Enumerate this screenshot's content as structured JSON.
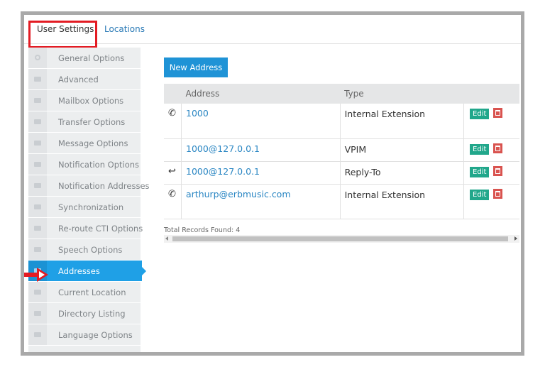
{
  "tabs": [
    {
      "label": "User Settings",
      "active": true
    },
    {
      "label": "Locations",
      "active": false
    }
  ],
  "sidebar": {
    "items": [
      {
        "label": "General Options",
        "icon": "gear-icon"
      },
      {
        "label": "Advanced",
        "icon": "envelope-icon"
      },
      {
        "label": "Mailbox Options",
        "icon": "envelope-icon"
      },
      {
        "label": "Transfer Options",
        "icon": "envelope-icon"
      },
      {
        "label": "Message Options",
        "icon": "envelope-icon"
      },
      {
        "label": "Notification Options",
        "icon": "envelope-icon"
      },
      {
        "label": "Notification Addresses",
        "icon": "envelope-icon"
      },
      {
        "label": "Synchronization",
        "icon": "envelope-icon"
      },
      {
        "label": "Re-route CTI Options",
        "icon": "envelope-icon"
      },
      {
        "label": "Speech Options",
        "icon": "envelope-icon"
      },
      {
        "label": "Addresses",
        "icon": "envelope-icon",
        "active": true
      },
      {
        "label": "Current Location",
        "icon": "envelope-icon"
      },
      {
        "label": "Directory Listing",
        "icon": "envelope-icon"
      },
      {
        "label": "Language Options",
        "icon": "envelope-icon"
      }
    ]
  },
  "main": {
    "new_button": "New Address",
    "table": {
      "headers": [
        "Address",
        "Type"
      ],
      "rows": [
        {
          "icon": "phone-icon",
          "icon_glyph": "✆",
          "address": "1000",
          "type": "Internal Extension",
          "edit": "Edit"
        },
        {
          "icon": "",
          "icon_glyph": "",
          "address": "1000@127.0.0.1",
          "type": "VPIM",
          "edit": "Edit"
        },
        {
          "icon": "reply-icon",
          "icon_glyph": "↩",
          "address": "1000@127.0.0.1",
          "type": "Reply-To",
          "edit": "Edit"
        },
        {
          "icon": "phone-icon",
          "icon_glyph": "✆",
          "address": "arthurp@erbmusic.com",
          "type": "Internal Extension",
          "edit": "Edit"
        }
      ]
    },
    "total_records": "Total Records Found: 4"
  },
  "colors": {
    "accent": "#1fa0e6",
    "edit": "#21a78b",
    "delete": "#d9534f",
    "highlight": "#e31b23"
  }
}
